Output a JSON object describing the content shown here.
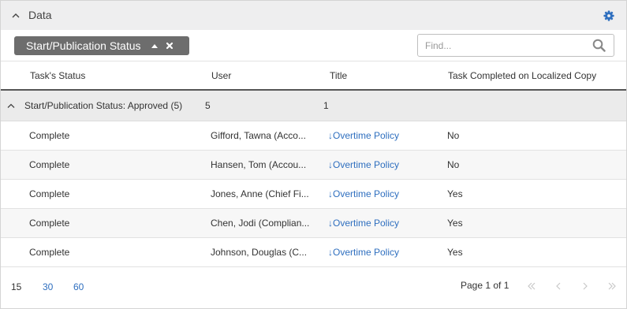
{
  "panel": {
    "title": "Data"
  },
  "grouping": {
    "chip_label": "Start/Publication Status"
  },
  "search": {
    "placeholder": "Find..."
  },
  "columns": [
    "Task's Status",
    "User",
    "Title",
    "Task Completed on Localized Copy"
  ],
  "group": {
    "label": "Start/Publication Status: Approved (5)",
    "user_count": "5",
    "title_count": "1"
  },
  "rows": [
    {
      "status": "Complete",
      "user": "Gifford, Tawna (Acco...",
      "title": "↓Overtime Policy",
      "completed": "No"
    },
    {
      "status": "Complete",
      "user": "Hansen, Tom (Accou...",
      "title": "↓Overtime Policy",
      "completed": "No"
    },
    {
      "status": "Complete",
      "user": "Jones, Anne (Chief Fi...",
      "title": "↓Overtime Policy",
      "completed": "Yes"
    },
    {
      "status": "Complete",
      "user": "Chen, Jodi (Complian...",
      "title": "↓Overtime Policy",
      "completed": "Yes"
    },
    {
      "status": "Complete",
      "user": "Johnson, Douglas (C...",
      "title": "↓Overtime Policy",
      "completed": "Yes"
    }
  ],
  "pager": {
    "page_sizes": [
      "15",
      "30",
      "60"
    ],
    "page_info": "Page 1 of 1"
  },
  "colors": {
    "accent": "#2f6fbf",
    "chip": "#6d6d6d",
    "header_bg": "#eeeeef"
  }
}
